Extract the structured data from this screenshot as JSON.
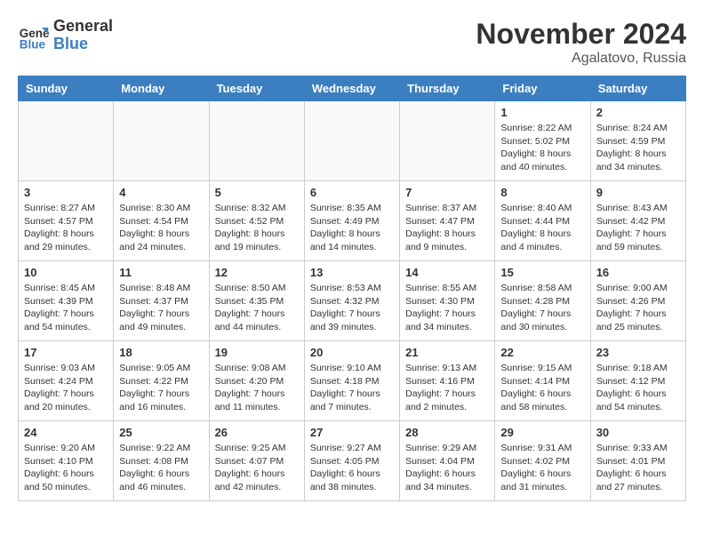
{
  "header": {
    "logo_line1": "General",
    "logo_line2": "Blue",
    "month": "November 2024",
    "location": "Agalatovo, Russia"
  },
  "weekdays": [
    "Sunday",
    "Monday",
    "Tuesday",
    "Wednesday",
    "Thursday",
    "Friday",
    "Saturday"
  ],
  "weeks": [
    [
      {
        "day": "",
        "detail": ""
      },
      {
        "day": "",
        "detail": ""
      },
      {
        "day": "",
        "detail": ""
      },
      {
        "day": "",
        "detail": ""
      },
      {
        "day": "",
        "detail": ""
      },
      {
        "day": "1",
        "detail": "Sunrise: 8:22 AM\nSunset: 5:02 PM\nDaylight: 8 hours and 40 minutes."
      },
      {
        "day": "2",
        "detail": "Sunrise: 8:24 AM\nSunset: 4:59 PM\nDaylight: 8 hours and 34 minutes."
      }
    ],
    [
      {
        "day": "3",
        "detail": "Sunrise: 8:27 AM\nSunset: 4:57 PM\nDaylight: 8 hours and 29 minutes."
      },
      {
        "day": "4",
        "detail": "Sunrise: 8:30 AM\nSunset: 4:54 PM\nDaylight: 8 hours and 24 minutes."
      },
      {
        "day": "5",
        "detail": "Sunrise: 8:32 AM\nSunset: 4:52 PM\nDaylight: 8 hours and 19 minutes."
      },
      {
        "day": "6",
        "detail": "Sunrise: 8:35 AM\nSunset: 4:49 PM\nDaylight: 8 hours and 14 minutes."
      },
      {
        "day": "7",
        "detail": "Sunrise: 8:37 AM\nSunset: 4:47 PM\nDaylight: 8 hours and 9 minutes."
      },
      {
        "day": "8",
        "detail": "Sunrise: 8:40 AM\nSunset: 4:44 PM\nDaylight: 8 hours and 4 minutes."
      },
      {
        "day": "9",
        "detail": "Sunrise: 8:43 AM\nSunset: 4:42 PM\nDaylight: 7 hours and 59 minutes."
      }
    ],
    [
      {
        "day": "10",
        "detail": "Sunrise: 8:45 AM\nSunset: 4:39 PM\nDaylight: 7 hours and 54 minutes."
      },
      {
        "day": "11",
        "detail": "Sunrise: 8:48 AM\nSunset: 4:37 PM\nDaylight: 7 hours and 49 minutes."
      },
      {
        "day": "12",
        "detail": "Sunrise: 8:50 AM\nSunset: 4:35 PM\nDaylight: 7 hours and 44 minutes."
      },
      {
        "day": "13",
        "detail": "Sunrise: 8:53 AM\nSunset: 4:32 PM\nDaylight: 7 hours and 39 minutes."
      },
      {
        "day": "14",
        "detail": "Sunrise: 8:55 AM\nSunset: 4:30 PM\nDaylight: 7 hours and 34 minutes."
      },
      {
        "day": "15",
        "detail": "Sunrise: 8:58 AM\nSunset: 4:28 PM\nDaylight: 7 hours and 30 minutes."
      },
      {
        "day": "16",
        "detail": "Sunrise: 9:00 AM\nSunset: 4:26 PM\nDaylight: 7 hours and 25 minutes."
      }
    ],
    [
      {
        "day": "17",
        "detail": "Sunrise: 9:03 AM\nSunset: 4:24 PM\nDaylight: 7 hours and 20 minutes."
      },
      {
        "day": "18",
        "detail": "Sunrise: 9:05 AM\nSunset: 4:22 PM\nDaylight: 7 hours and 16 minutes."
      },
      {
        "day": "19",
        "detail": "Sunrise: 9:08 AM\nSunset: 4:20 PM\nDaylight: 7 hours and 11 minutes."
      },
      {
        "day": "20",
        "detail": "Sunrise: 9:10 AM\nSunset: 4:18 PM\nDaylight: 7 hours and 7 minutes."
      },
      {
        "day": "21",
        "detail": "Sunrise: 9:13 AM\nSunset: 4:16 PM\nDaylight: 7 hours and 2 minutes."
      },
      {
        "day": "22",
        "detail": "Sunrise: 9:15 AM\nSunset: 4:14 PM\nDaylight: 6 hours and 58 minutes."
      },
      {
        "day": "23",
        "detail": "Sunrise: 9:18 AM\nSunset: 4:12 PM\nDaylight: 6 hours and 54 minutes."
      }
    ],
    [
      {
        "day": "24",
        "detail": "Sunrise: 9:20 AM\nSunset: 4:10 PM\nDaylight: 6 hours and 50 minutes."
      },
      {
        "day": "25",
        "detail": "Sunrise: 9:22 AM\nSunset: 4:08 PM\nDaylight: 6 hours and 46 minutes."
      },
      {
        "day": "26",
        "detail": "Sunrise: 9:25 AM\nSunset: 4:07 PM\nDaylight: 6 hours and 42 minutes."
      },
      {
        "day": "27",
        "detail": "Sunrise: 9:27 AM\nSunset: 4:05 PM\nDaylight: 6 hours and 38 minutes."
      },
      {
        "day": "28",
        "detail": "Sunrise: 9:29 AM\nSunset: 4:04 PM\nDaylight: 6 hours and 34 minutes."
      },
      {
        "day": "29",
        "detail": "Sunrise: 9:31 AM\nSunset: 4:02 PM\nDaylight: 6 hours and 31 minutes."
      },
      {
        "day": "30",
        "detail": "Sunrise: 9:33 AM\nSunset: 4:01 PM\nDaylight: 6 hours and 27 minutes."
      }
    ]
  ]
}
